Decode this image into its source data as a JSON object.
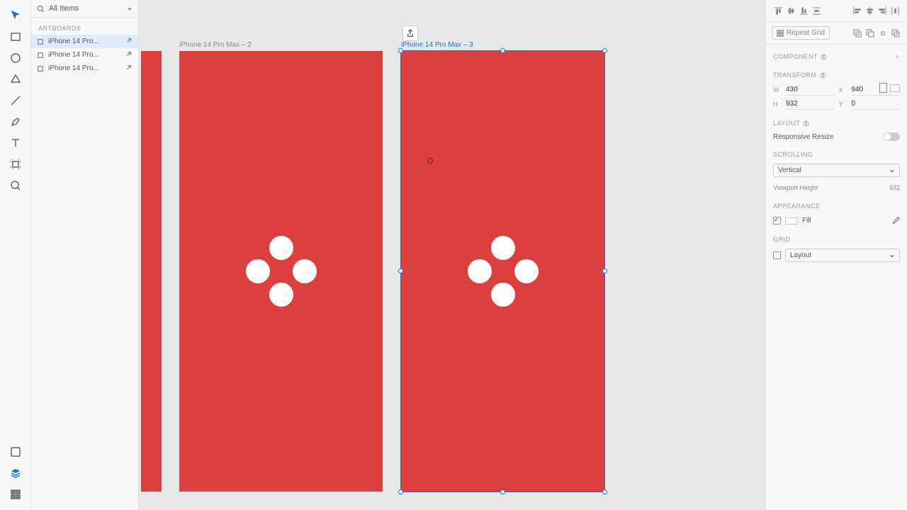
{
  "layers": {
    "search_label": "All Items",
    "header": "ARTBOARDS",
    "items": [
      {
        "name": "iPhone 14 Pro..."
      },
      {
        "name": "iPhone 14 Pro..."
      },
      {
        "name": "iPhone 14 Pro..."
      }
    ]
  },
  "canvas": {
    "ab2_label": "iPhone 14 Pro Max – 2",
    "ab3_label": "iPhone 14 Pro Max – 3"
  },
  "panel": {
    "repeat_label": "Repeat Grid",
    "component_hdr": "COMPONENT",
    "transform_hdr": "TRANSFORM",
    "w_lbl": "W",
    "w_val": "430",
    "x_lbl": "X",
    "x_val": "940",
    "h_lbl": "H",
    "h_val": "932",
    "y_lbl": "Y",
    "y_val": "0",
    "layout_hdr": "LAYOUT",
    "responsive_label": "Responsive Resize",
    "scrolling_hdr": "SCROLLING",
    "scrolling_val": "Vertical",
    "vh_label": "Viewport Height",
    "vh_val": "932",
    "appearance_hdr": "APPEARANCE",
    "fill_label": "Fill",
    "grid_hdr": "GRID",
    "grid_dd": "Layout"
  }
}
